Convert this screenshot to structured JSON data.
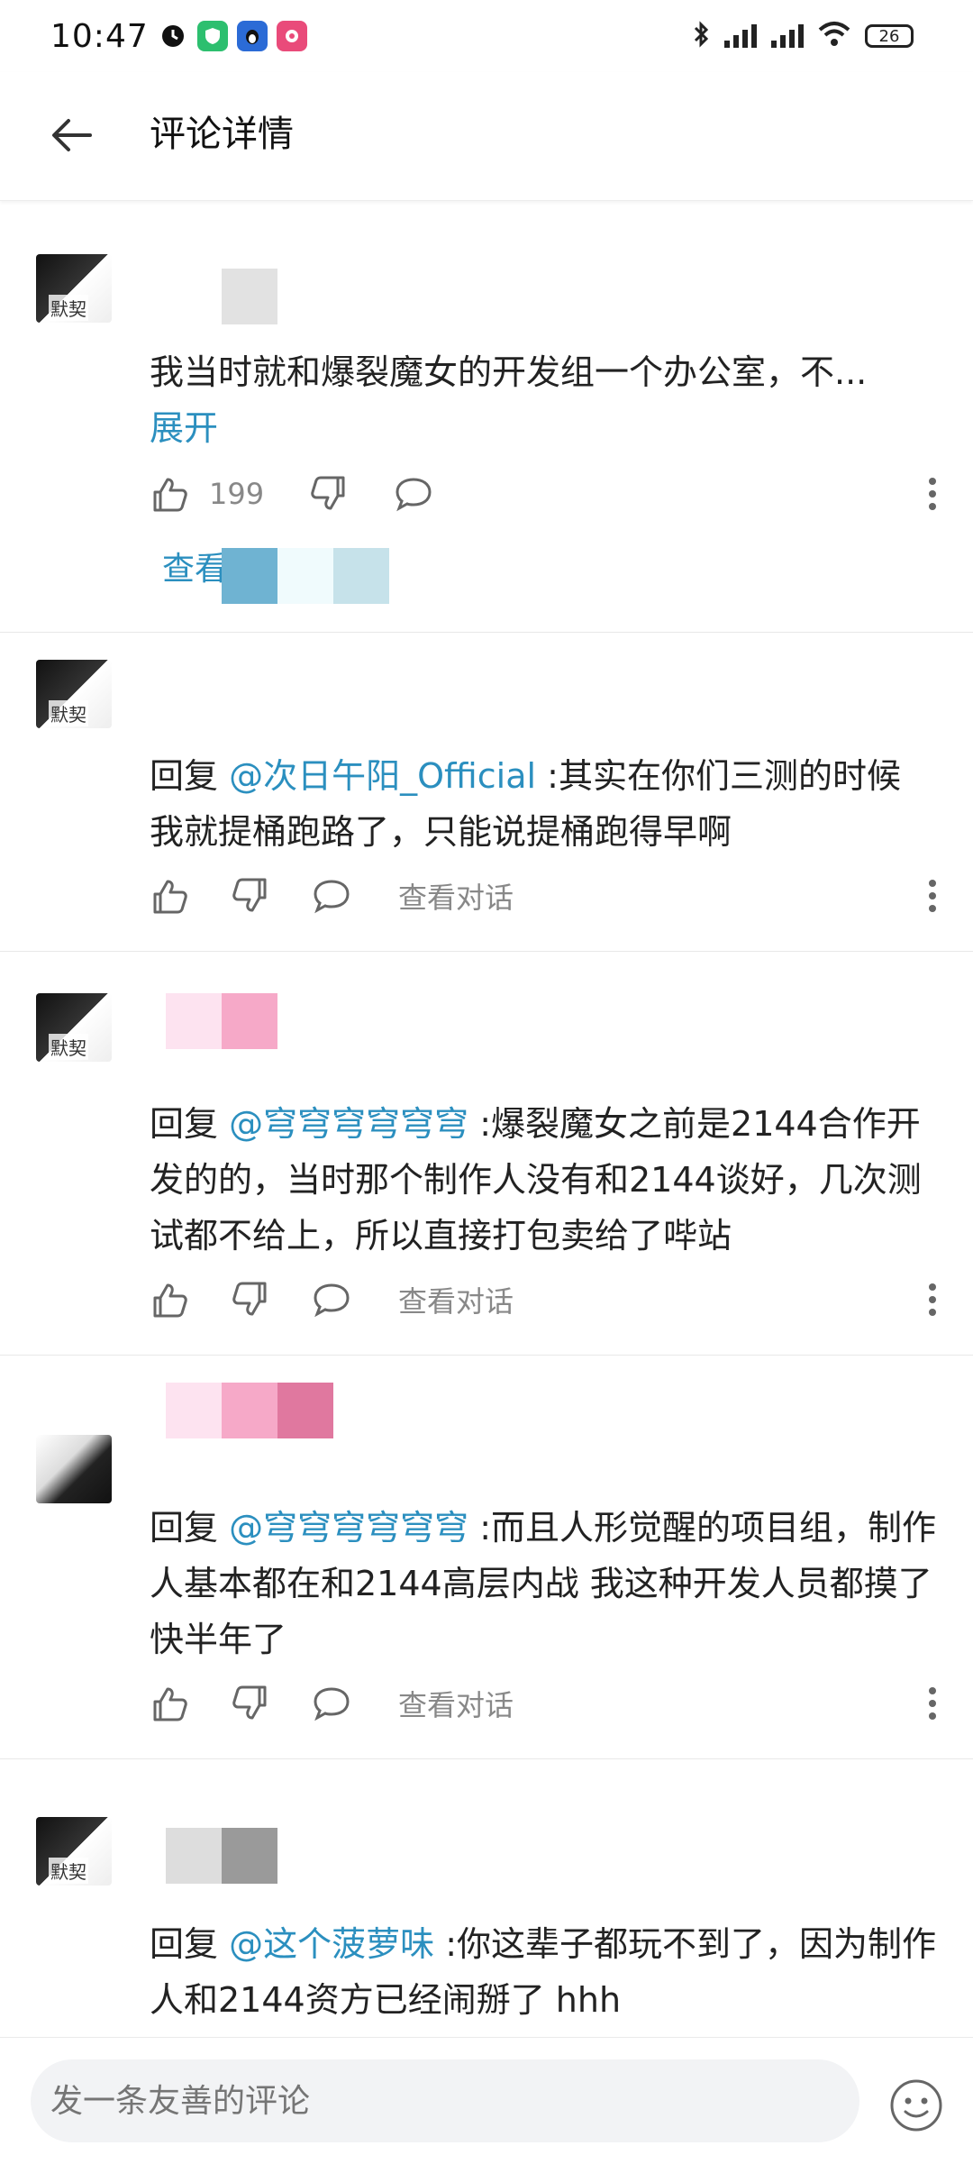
{
  "status_bar": {
    "time": "10:47",
    "battery": "26"
  },
  "header": {
    "title": "评论详情"
  },
  "comments": [
    {
      "avatar_name": "默契",
      "text": "我当时就和爆裂魔女的开发组一个办公室，不...",
      "expand_label": "展开",
      "likes": "199",
      "view_replies_label": "查看视"
    },
    {
      "avatar_name": "默契",
      "reply_prefix": "回复",
      "mention": "@次日午阳_Official",
      "text": ":其实在你们三测的时候 我就提桶跑路了，只能说提桶跑得早啊",
      "dialog_label": "查看对话"
    },
    {
      "avatar_name": "默契",
      "reply_prefix": "回复",
      "mention": "@穹穹穹穹穹穹",
      "text": ":爆裂魔女之前是2144合作开发的的，当时那个制作人没有和2144谈好，几次测试都不给上，所以直接打包卖给了哔站",
      "dialog_label": "查看对话"
    },
    {
      "avatar_name": "",
      "reply_prefix": "回复",
      "mention": "@穹穹穹穹穹穹",
      "text": ":而且人形觉醒的项目组，制作人基本都在和2144高层内战 我这种开发人员都摸了快半年了",
      "dialog_label": "查看对话"
    },
    {
      "avatar_name": "默契",
      "reply_prefix": "回复",
      "mention": "@这个菠萝味",
      "text": ":你这辈子都玩不到了，因为制作人和2144资方已经闹掰了  hhh"
    }
  ],
  "bottom": {
    "placeholder": "发一条友善的评论"
  },
  "icons": {
    "back": "back-arrow-icon",
    "like": "thumbs-up-icon",
    "dislike": "thumbs-down-icon",
    "reply": "speech-bubble-icon",
    "more": "more-vertical-icon",
    "emoji": "smiley-icon"
  },
  "colors": {
    "link": "#2b8fbf",
    "muted": "#888888"
  }
}
